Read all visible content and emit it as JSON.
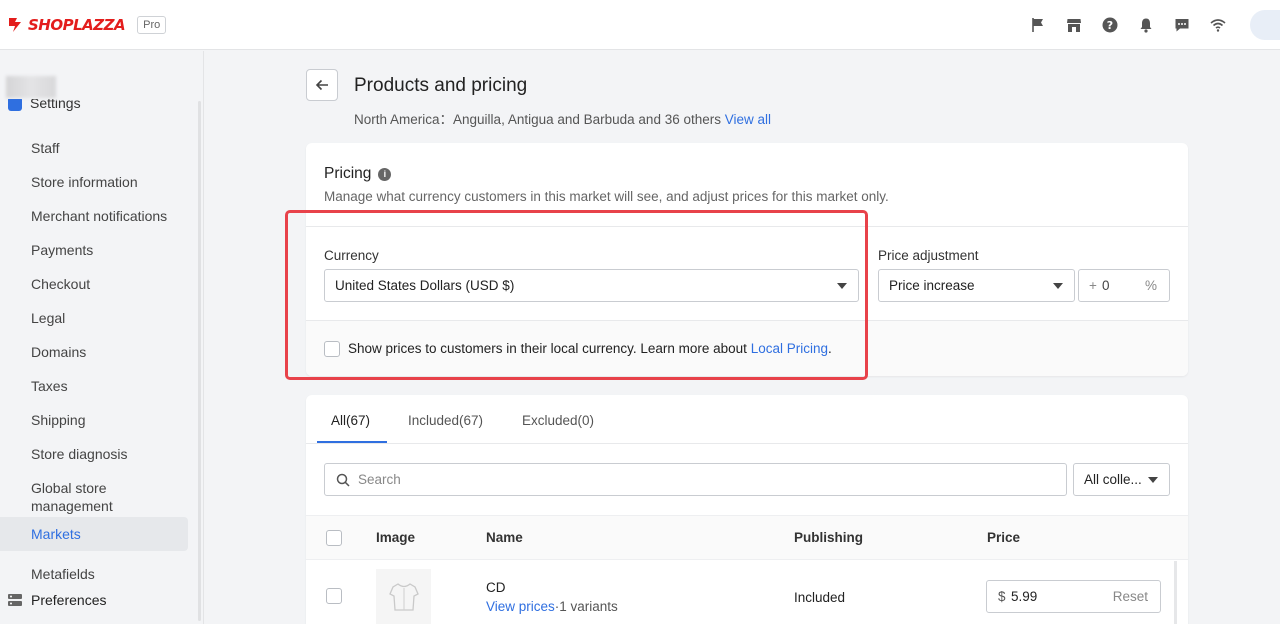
{
  "brand": {
    "logo_text": "SHOPLAZZA",
    "plan_badge": "Pro",
    "accent": "#e31d1c"
  },
  "topbar_icons": [
    "flag-icon",
    "store-icon",
    "help-icon",
    "bell-icon",
    "chat-icon",
    "wifi-icon"
  ],
  "sidebar": {
    "section": "Settings",
    "items": [
      {
        "label": "Staff",
        "active": false
      },
      {
        "label": "Store information",
        "active": false
      },
      {
        "label": "Merchant notifications",
        "active": false
      },
      {
        "label": "Payments",
        "active": false
      },
      {
        "label": "Checkout",
        "active": false
      },
      {
        "label": "Legal",
        "active": false
      },
      {
        "label": "Domains",
        "active": false
      },
      {
        "label": "Taxes",
        "active": false
      },
      {
        "label": "Shipping",
        "active": false
      },
      {
        "label": "Store diagnosis",
        "active": false
      },
      {
        "label": "Global store management",
        "active": false
      },
      {
        "label": "Markets",
        "active": true
      },
      {
        "label": "Metafields",
        "active": false
      }
    ],
    "preferences_label": "Preferences"
  },
  "header": {
    "title": "Products and pricing",
    "subtitle_prefix": "North America：Anguilla,  Antigua and Barbuda and 36 others",
    "view_all": "View all"
  },
  "pricing": {
    "title": "Pricing",
    "description": "Manage what currency customers in this market will see, and adjust prices for this market only.",
    "currency_label": "Currency",
    "currency_value": "United States Dollars (USD $)",
    "adjustment_label": "Price adjustment",
    "adjustment_value": "Price increase",
    "adjustment_plus": "+",
    "adjustment_amount": "0",
    "adjustment_unit": "%",
    "local_text": "Show prices to customers in their local currency. Learn more about",
    "local_link": "Local Pricing",
    "local_period": ".",
    "local_checked": false
  },
  "products": {
    "tabs": [
      {
        "label": "All(67)",
        "active": true
      },
      {
        "label": "Included(67)",
        "active": false
      },
      {
        "label": "Excluded(0)",
        "active": false
      }
    ],
    "search_placeholder": "Search",
    "collection_filter": "All colle...",
    "columns": {
      "image": "Image",
      "name": "Name",
      "publishing": "Publishing",
      "price": "Price"
    },
    "rows": [
      {
        "name": "CD",
        "view_prices": "View prices",
        "variants": "·1 variants",
        "publishing": "Included",
        "currency": "$",
        "price": "5.99",
        "reset": "Reset"
      }
    ]
  }
}
